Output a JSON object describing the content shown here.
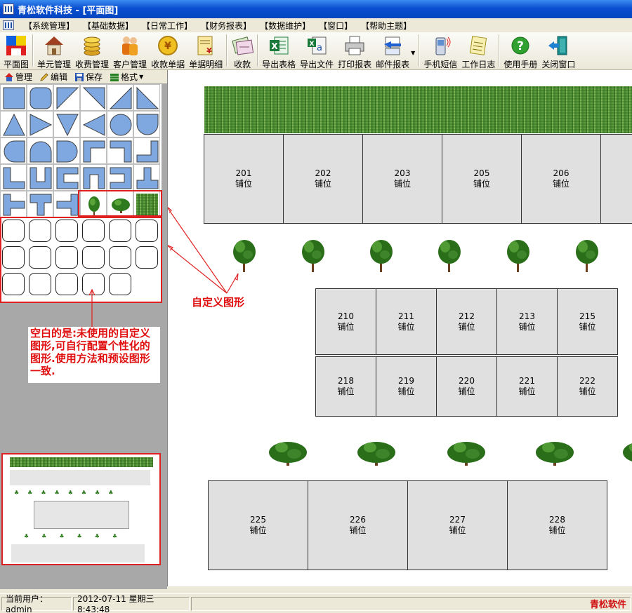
{
  "window": {
    "title": "青松软件科技 - [平面图]"
  },
  "menu": [
    "【系统管理】",
    "【基础数据】",
    "【日常工作】",
    "【财务报表】",
    "【数据维护】",
    "【窗口】",
    "【帮助主题】"
  ],
  "toolbar": [
    {
      "label": "平面图",
      "icon": "floorplan-icon"
    },
    {
      "label": "单元管理",
      "icon": "house-icon"
    },
    {
      "label": "收费管理",
      "icon": "coins-icon"
    },
    {
      "label": "客户管理",
      "icon": "users-icon"
    },
    {
      "label": "收款单据",
      "icon": "yen-icon"
    },
    {
      "label": "单据明细",
      "icon": "receipt-icon"
    },
    {
      "label": "收款",
      "icon": "payment-icon"
    },
    {
      "label": "导出表格",
      "icon": "excel-icon"
    },
    {
      "label": "导出文件",
      "icon": "export-file-icon"
    },
    {
      "label": "打印报表",
      "icon": "printer-icon"
    },
    {
      "label": "邮件报表",
      "icon": "email-icon"
    },
    {
      "label": "手机短信",
      "icon": "phone-icon"
    },
    {
      "label": "工作日志",
      "icon": "notepad-icon"
    },
    {
      "label": "使用手册",
      "icon": "help-icon"
    },
    {
      "label": "关闭窗口",
      "icon": "exit-icon"
    }
  ],
  "panel_tabs": [
    {
      "label": "管理",
      "icon": "home-icon"
    },
    {
      "label": "编辑",
      "icon": "pencil-icon"
    },
    {
      "label": "保存",
      "icon": "save-icon"
    },
    {
      "label": "格式",
      "icon": "format-icon"
    }
  ],
  "annotations": {
    "custom_shapes": "自定义图形",
    "blank_note": "空白的是:未使用的自定义图形,可自行配置个性化的图形.使用方法和预设图形一致."
  },
  "rows": {
    "row1": [
      {
        "num": "201",
        "type": "铺位"
      },
      {
        "num": "202",
        "type": "铺位"
      },
      {
        "num": "203",
        "type": "铺位"
      },
      {
        "num": "205",
        "type": "铺位"
      },
      {
        "num": "206",
        "type": "铺位"
      },
      {
        "num": "",
        "type": "铺"
      }
    ],
    "row2": [
      {
        "num": "210",
        "type": "铺位"
      },
      {
        "num": "211",
        "type": "铺位"
      },
      {
        "num": "212",
        "type": "铺位"
      },
      {
        "num": "213",
        "type": "铺位"
      },
      {
        "num": "215",
        "type": "铺位"
      }
    ],
    "row3": [
      {
        "num": "218",
        "type": "铺位"
      },
      {
        "num": "219",
        "type": "铺位"
      },
      {
        "num": "220",
        "type": "铺位"
      },
      {
        "num": "221",
        "type": "铺位"
      },
      {
        "num": "222",
        "type": "铺位"
      }
    ],
    "row4": [
      {
        "num": "225",
        "type": "铺位"
      },
      {
        "num": "226",
        "type": "铺位"
      },
      {
        "num": "227",
        "type": "铺位"
      },
      {
        "num": "228",
        "type": "铺位"
      }
    ]
  },
  "status": {
    "user_label": "当前用户：admin",
    "datetime": "2012-07-11 星期三 8:43:48",
    "brand": "青松软件"
  },
  "colors": {
    "shape_fill": "#7fa8e0",
    "annot_red": "#e02020",
    "unit_bg": "#e0e0e0",
    "title_blue": "#0a4fd0"
  }
}
